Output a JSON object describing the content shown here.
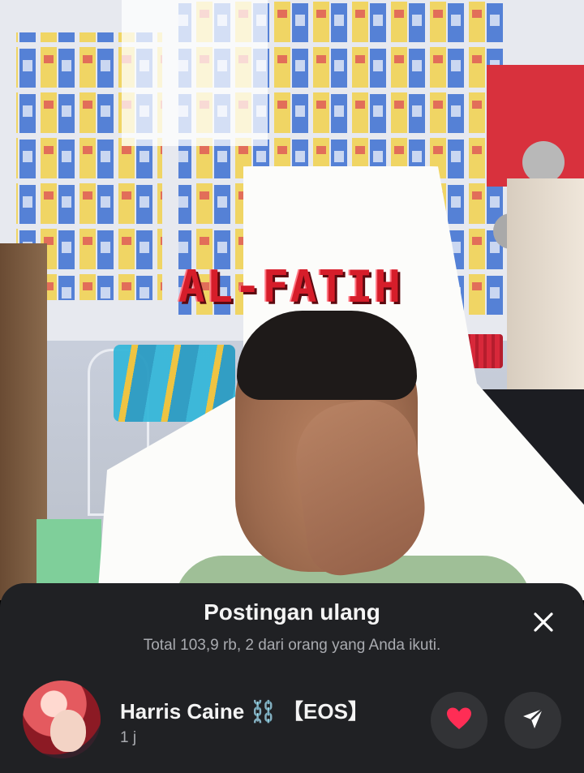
{
  "video": {
    "overlay_title": "AL-FATIH"
  },
  "sheet": {
    "title": "Postingan ulang",
    "subtitle": "Total 103,9 rb, 2 dari orang yang Anda ikuti.",
    "close_icon": "close-icon"
  },
  "reposter": {
    "name": "Harris Caine ⛓️ 【EOS】",
    "time": "1 j",
    "like_icon": "heart-icon",
    "like_color": "#ff2d55",
    "share_icon": "send-icon"
  },
  "colors": {
    "sheet_bg": "#202124",
    "button_bg": "#323336",
    "title_red": "#d61d2a"
  }
}
